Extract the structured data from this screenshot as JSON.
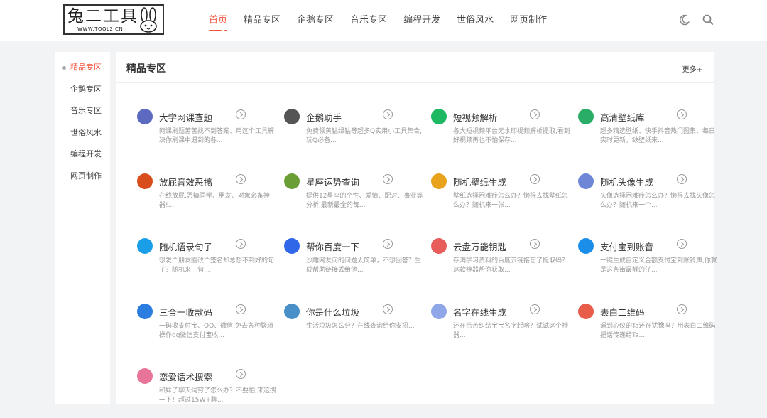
{
  "logo": {
    "title": "兔二工具",
    "subtitle": "WWW.TOOL2.CN"
  },
  "nav": [
    "首页",
    "精品专区",
    "企鹅专区",
    "音乐专区",
    "编程开发",
    "世俗风水",
    "网页制作"
  ],
  "sidebar": [
    "精品专区",
    "企鹅专区",
    "音乐专区",
    "世俗风水",
    "编程开发",
    "网页制作"
  ],
  "main": {
    "title": "精品专区",
    "more": "更多+"
  },
  "cards": [
    {
      "title": "大学网课查题",
      "desc": "网课刷题苦苦找不到答案、用这个工具解决你刷课中遇到的各...",
      "icon": "laptop-icon",
      "color": "#5c6bc0"
    },
    {
      "title": "企鹅助手",
      "desc": "免费领黄钻绿钻等超多Q实用小工具集合,玩Q必备...",
      "icon": "penguin-icon",
      "color": "#555555"
    },
    {
      "title": "短视频解析",
      "desc": "各大短视频平台无水印视频解析提取,看到好视频再也不怕保存...",
      "icon": "video-play-icon",
      "color": "#1eb863"
    },
    {
      "title": "高清壁纸库",
      "desc": "超多精选壁纸、快手抖音热门图集，每日实时更新，缺壁纸来...",
      "icon": "picture-icon",
      "color": "#2aae67"
    },
    {
      "title": "放屁音效恶搞",
      "desc": "在线放屁,恶搞同学、朋友、对象必备神器!...",
      "icon": "fart-icon",
      "color": "#d84d1b"
    },
    {
      "title": "星座运势查询",
      "desc": "提供12星座的个性、爱情、配对、事业等分析,最新最全的每...",
      "icon": "constellation-icon",
      "color": "#6b9e35"
    },
    {
      "title": "随机壁纸生成",
      "desc": "壁纸选择困难症怎么办？懒得去找壁纸怎么办？随机来一张...",
      "icon": "color-wheel-icon",
      "color": "#e8a21c"
    },
    {
      "title": "随机头像生成",
      "desc": "头像选择困难症怎么办？懒得去找头像怎么办？随机来一个...",
      "icon": "avatar-icon",
      "color": "#6f86d6"
    },
    {
      "title": "随机语录句子",
      "desc": "想发个朋友圈改个签名却总想不到好的句子？随机来一句...",
      "icon": "quote-icon",
      "color": "#1a9ee8"
    },
    {
      "title": "帮你百度一下",
      "desc": "沙雕网友问的问题太简单，不想回答？生成帮助链接丢给他...",
      "icon": "baidu-paw-icon",
      "color": "#2f67e8"
    },
    {
      "title": "云盘万能钥匙",
      "desc": "存满学习资料的百度云链接忘了提取码？这款神器帮你获取...",
      "icon": "key-icon",
      "color": "#e85c5c"
    },
    {
      "title": "支付宝到账音",
      "desc": "一键生成自定义金额支付宝到账铃声,你就是这条街最靓的仔...",
      "icon": "sound-wave-icon",
      "color": "#1a8ee8"
    },
    {
      "title": "三合一收款码",
      "desc": "一码收支付宝、QQ、微信,免去各种繁琐操作qq微信支付宝收...",
      "icon": "qr-scan-icon",
      "color": "#2b7de0"
    },
    {
      "title": "你是什么垃圾",
      "desc": "生活垃圾怎么分？在线查询给你支招...",
      "icon": "trash-bin-icon",
      "color": "#4a90c8"
    },
    {
      "title": "名字在线生成",
      "desc": "还在苦苦纠结宝宝名字起啥？试试这个神器...",
      "icon": "user-icon",
      "color": "#8fa6e8"
    },
    {
      "title": "表白二维码",
      "desc": "遇到心仪的Ta还在犹豫吗？用表白二维码把话传递给Ta...",
      "icon": "qr-code-icon",
      "color": "#e85c4a"
    },
    {
      "title": "恋爱话术搜索",
      "desc": "和妹子聊天词穷了怎么办？不要怕,来这搜一下！超过15W+聊...",
      "icon": "heart-chat-icon",
      "color": "#e8749a"
    }
  ]
}
